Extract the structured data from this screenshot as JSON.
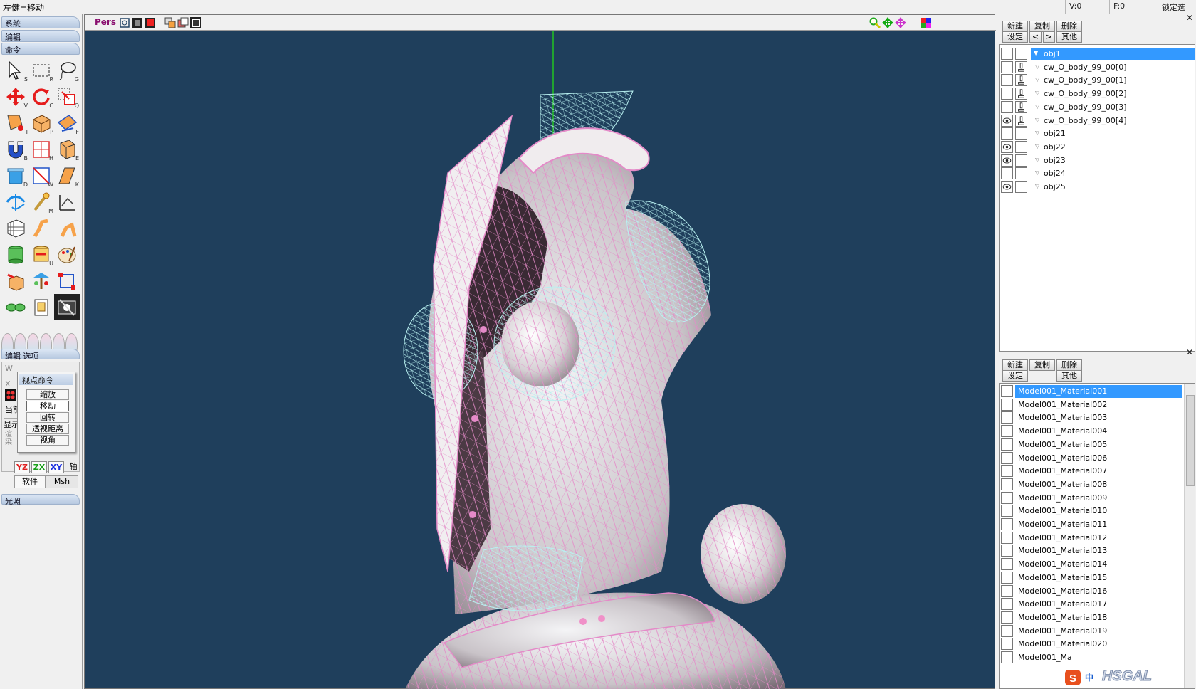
{
  "topbar": {
    "hint": "左健=移动",
    "v_count": "V:0",
    "f_count": "F:0",
    "lock_select": "锁定选择"
  },
  "left": {
    "sections": {
      "system": "系统",
      "edit": "编辑",
      "command": "命令",
      "edit_options": "编辑 选项",
      "lighting": "光照"
    },
    "tools": [
      {
        "name": "select-arrow-icon",
        "key": "S"
      },
      {
        "name": "rect-select-icon",
        "key": "R"
      },
      {
        "name": "lasso-icon",
        "key": "G"
      },
      {
        "name": "move-icon",
        "key": "V"
      },
      {
        "name": "rotate-icon",
        "key": "C"
      },
      {
        "name": "scale-icon",
        "key": "Q"
      },
      {
        "name": "face-create-icon",
        "key": "I"
      },
      {
        "name": "primitive-box-icon",
        "key": "P"
      },
      {
        "name": "flip-face-icon",
        "key": "F"
      },
      {
        "name": "magnet-icon",
        "key": "B"
      },
      {
        "name": "knife-grid-icon",
        "key": "H"
      },
      {
        "name": "extrude-icon",
        "key": "E"
      },
      {
        "name": "delete-bucket-icon",
        "key": "D"
      },
      {
        "name": "weld-icon",
        "key": "W"
      },
      {
        "name": "bevel-icon",
        "key": "K"
      },
      {
        "name": "bend-axis-icon",
        "key": ""
      },
      {
        "name": "paint-stick-icon",
        "key": "M"
      },
      {
        "name": "plane-axis-icon",
        "key": ""
      },
      {
        "name": "lattice-icon",
        "key": ""
      },
      {
        "name": "curve-icon",
        "key": ""
      },
      {
        "name": "path-icon",
        "key": ""
      },
      {
        "name": "db-green-icon",
        "key": ""
      },
      {
        "name": "db-red-icon",
        "key": "U"
      },
      {
        "name": "palette-icon",
        "key": ""
      },
      {
        "name": "box-arrow-icon",
        "key": ""
      },
      {
        "name": "tree-icon",
        "key": ""
      },
      {
        "name": "node-rect-icon",
        "key": ""
      },
      {
        "name": "link-icon",
        "key": ""
      },
      {
        "name": "doc-icon",
        "key": ""
      },
      {
        "name": "film-icon",
        "key": ""
      }
    ],
    "sub": {
      "w_tab": "W",
      "x_tab": "X",
      "current": "当前",
      "display": "显示",
      "tex": "渲染"
    },
    "popup": {
      "title": "视点命令",
      "items": [
        "缩放",
        "移动",
        "回转",
        "透视距离",
        "视角"
      ]
    },
    "axis": [
      "YZ",
      "ZX",
      "XY",
      "轴"
    ],
    "render_tabs": [
      "软件",
      "Msh"
    ]
  },
  "viewport": {
    "mode": "Pers"
  },
  "right": {
    "obj_toolbar": {
      "new": "新建",
      "copy": "复制",
      "delete": "删除",
      "settings": "设定",
      "prev": "<",
      "next": ">",
      "other": "其他"
    },
    "objects": [
      {
        "name": "obj1",
        "visible": false,
        "locked": false,
        "selected": true,
        "tri": "▼"
      },
      {
        "name": "cw_O_body_99_00[0]",
        "visible": false,
        "locked": true,
        "selected": false,
        "tri": "▽"
      },
      {
        "name": "cw_O_body_99_00[1]",
        "visible": false,
        "locked": true,
        "selected": false,
        "tri": "▽"
      },
      {
        "name": "cw_O_body_99_00[2]",
        "visible": false,
        "locked": true,
        "selected": false,
        "tri": "▽"
      },
      {
        "name": "cw_O_body_99_00[3]",
        "visible": false,
        "locked": true,
        "selected": false,
        "tri": "▽"
      },
      {
        "name": "cw_O_body_99_00[4]",
        "visible": true,
        "locked": true,
        "selected": false,
        "tri": "▽"
      },
      {
        "name": "obj21",
        "visible": false,
        "locked": false,
        "selected": false,
        "tri": "▽"
      },
      {
        "name": "obj22",
        "visible": true,
        "locked": false,
        "selected": false,
        "tri": "▽"
      },
      {
        "name": "obj23",
        "visible": true,
        "locked": false,
        "selected": false,
        "tri": "▽"
      },
      {
        "name": "obj24",
        "visible": false,
        "locked": false,
        "selected": false,
        "tri": "▽"
      },
      {
        "name": "obj25",
        "visible": true,
        "locked": false,
        "selected": false,
        "tri": "▽"
      }
    ],
    "mat_toolbar": {
      "new": "新建",
      "copy": "复制",
      "delete": "删除",
      "settings": "设定",
      "other": "其他"
    },
    "materials": [
      "Model001_Material001",
      "Model001_Material002",
      "Model001_Material003",
      "Model001_Material004",
      "Model001_Material005",
      "Model001_Material006",
      "Model001_Material007",
      "Model001_Material008",
      "Model001_Material009",
      "Model001_Material010",
      "Model001_Material011",
      "Model001_Material012",
      "Model001_Material013",
      "Model001_Material014",
      "Model001_Material015",
      "Model001_Material016",
      "Model001_Material017",
      "Model001_Material018",
      "Model001_Material019",
      "Model001_Material020",
      "Model001_Ma"
    ],
    "tray": {
      "ime": "中",
      "brand": "HSGAL"
    }
  },
  "colors": {
    "viewport_bg": "#1f3f5c",
    "selection": "#3399ff",
    "wire_pink": "#e48ac8",
    "wire_cyan": "#b8f0f0",
    "pers_text": "#8a1070"
  }
}
